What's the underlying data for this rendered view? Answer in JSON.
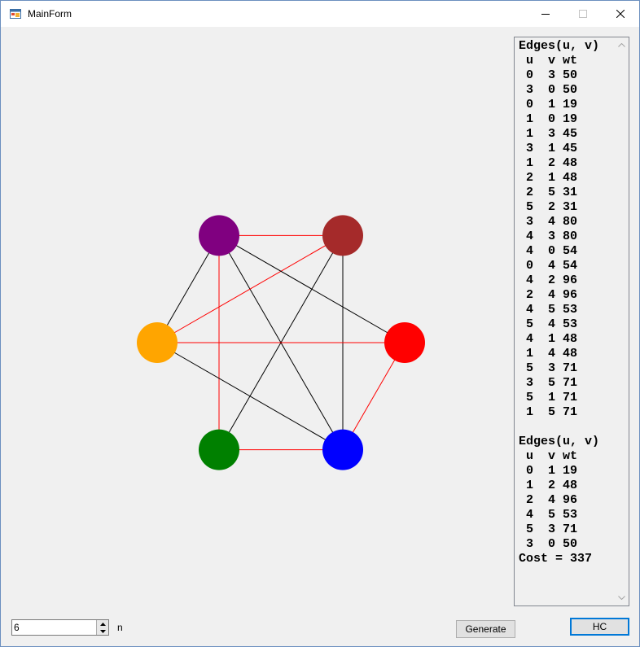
{
  "window": {
    "title": "MainForm",
    "icon": "form-icon",
    "controls": {
      "minimize_icon": "minimize-icon",
      "maximize_icon": "maximize-icon",
      "close_icon": "close-icon"
    }
  },
  "graph": {
    "nodes": [
      {
        "id": 0,
        "color": "#800080"
      },
      {
        "id": 1,
        "color": "#a52a2a"
      },
      {
        "id": 2,
        "color": "#ff0000"
      },
      {
        "id": 3,
        "color": "#0000ff"
      },
      {
        "id": 4,
        "color": "#008000"
      },
      {
        "id": 5,
        "color": "#ffa500"
      }
    ],
    "edge_colors": {
      "path": "#ff0000",
      "other": "#000000"
    },
    "edges": [
      {
        "u": 0,
        "v": 1,
        "in_path": true
      },
      {
        "u": 0,
        "v": 3,
        "in_path": false
      },
      {
        "u": 0,
        "v": 4,
        "in_path": true
      },
      {
        "u": 0,
        "v": 5,
        "in_path": false
      },
      {
        "u": 1,
        "v": 3,
        "in_path": false
      },
      {
        "u": 1,
        "v": 4,
        "in_path": false
      },
      {
        "u": 1,
        "v": 5,
        "in_path": true
      },
      {
        "u": 2,
        "v": 3,
        "in_path": true
      },
      {
        "u": 2,
        "v": 5,
        "in_path": true
      },
      {
        "u": 3,
        "v": 4,
        "in_path": true
      },
      {
        "u": 3,
        "v": 5,
        "in_path": false
      },
      {
        "u": 0,
        "v": 2,
        "in_path": false
      }
    ]
  },
  "output": {
    "text": "Edges(u, v)\n u  v wt\n 0  3 50\n 3  0 50\n 0  1 19\n 1  0 19\n 1  3 45\n 3  1 45\n 1  2 48\n 2  1 48\n 2  5 31\n 5  2 31\n 3  4 80\n 4  3 80\n 4  0 54\n 0  4 54\n 4  2 96\n 2  4 96\n 4  5 53\n 5  4 53\n 4  1 48\n 1  4 48\n 5  3 71\n 3  5 71\n 5  1 71\n 1  5 71\n\nEdges(u, v)\n u  v wt\n 0  1 19\n 1  2 48\n 2  4 96\n 4  5 53\n 5  3 71\n 3  0 50\nCost = 337"
  },
  "controls": {
    "n_value": "6",
    "n_label": "n",
    "generate_label": "Generate",
    "hc_label": "HC"
  }
}
